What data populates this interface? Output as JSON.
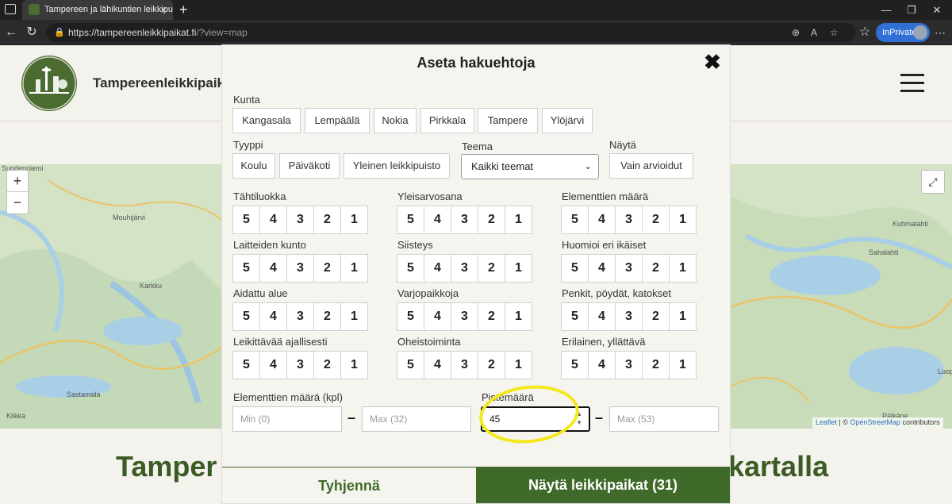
{
  "browser": {
    "tab_title": "Tampereen ja lähikuntien leikkipu",
    "url_domain": "https://tampereenleikkipaikat.fi",
    "url_path": "/?view=map",
    "inprivate_label": "InPrivate"
  },
  "site": {
    "title": "Tampereenleikkipaik",
    "heading_left": "Tamper",
    "heading_right": "kartalla"
  },
  "map": {
    "zoom_in": "+",
    "zoom_out": "−",
    "labels": [
      "Suodenniemi",
      "Mouhijärvi",
      "Karkku",
      "Sastamala",
      "Kiikka",
      "Kuhmalahti",
      "Sahalahti",
      "Pälkäne",
      "Luop"
    ],
    "attribution_leaflet": "Leaflet",
    "attribution_sep": " | © ",
    "attribution_osm": "OpenStreetMap",
    "attribution_tail": " contributors"
  },
  "modal": {
    "title": "Aseta hakuehtoja",
    "kunta_label": "Kunta",
    "kunta_options": [
      "Kangasala",
      "Lempäälä",
      "Nokia",
      "Pirkkala",
      "Tampere",
      "Ylöjärvi"
    ],
    "tyyppi_label": "Tyyppi",
    "tyyppi_options": [
      "Koulu",
      "Päiväkoti",
      "Yleinen leikkipuisto"
    ],
    "teema_label": "Teema",
    "teema_value": "Kaikki teemat",
    "nayta_label": "Näytä",
    "nayta_option": "Vain arvioidut",
    "ratings": [
      {
        "label": "Tähtiluokka"
      },
      {
        "label": "Yleisarvosana"
      },
      {
        "label": "Elementtien määrä"
      },
      {
        "label": "Laitteiden kunto"
      },
      {
        "label": "Siisteys"
      },
      {
        "label": "Huomioi eri ikäiset"
      },
      {
        "label": "Aidattu alue"
      },
      {
        "label": "Varjopaikkoja"
      },
      {
        "label": "Penkit, pöydät, katokset"
      },
      {
        "label": "Leikittävää ajallisesti"
      },
      {
        "label": "Oheistoiminta"
      },
      {
        "label": "Erilainen, yllättävä"
      }
    ],
    "rating_values": [
      "5",
      "4",
      "3",
      "2",
      "1"
    ],
    "elements_label": "Elementtien määrä (kpl)",
    "elements_min_placeholder": "Min (0)",
    "elements_max_placeholder": "Max (32)",
    "points_label": "Pistemäärä",
    "points_min_value": "45",
    "points_max_placeholder": "Max (53)",
    "range_dash": "–",
    "clear_button": "Tyhjennä",
    "show_button": "Näytä leikkipaikat  (31)"
  }
}
